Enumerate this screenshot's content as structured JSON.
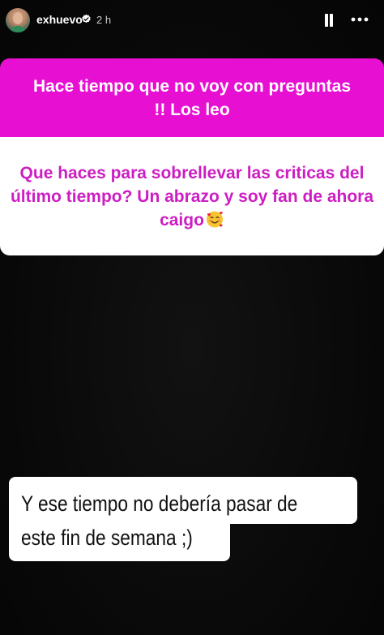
{
  "header": {
    "username": "exhuevo",
    "time": "2 h"
  },
  "question": {
    "prompt": "Hace tiempo que no voy con preguntas !! Los leo",
    "response": "Que haces para sobrellevar las criticas del último tiempo? Un abrazo y soy fan de ahora caigo",
    "response_emoji": "smiling-face-with-hearts"
  },
  "answer": {
    "line1": "Y ese tiempo no debería pasar de",
    "line2": "este fin de semana ;)"
  },
  "colors": {
    "question_header_bg": "#e710d2",
    "question_text": "#cc1ec2",
    "background": "#090909"
  }
}
